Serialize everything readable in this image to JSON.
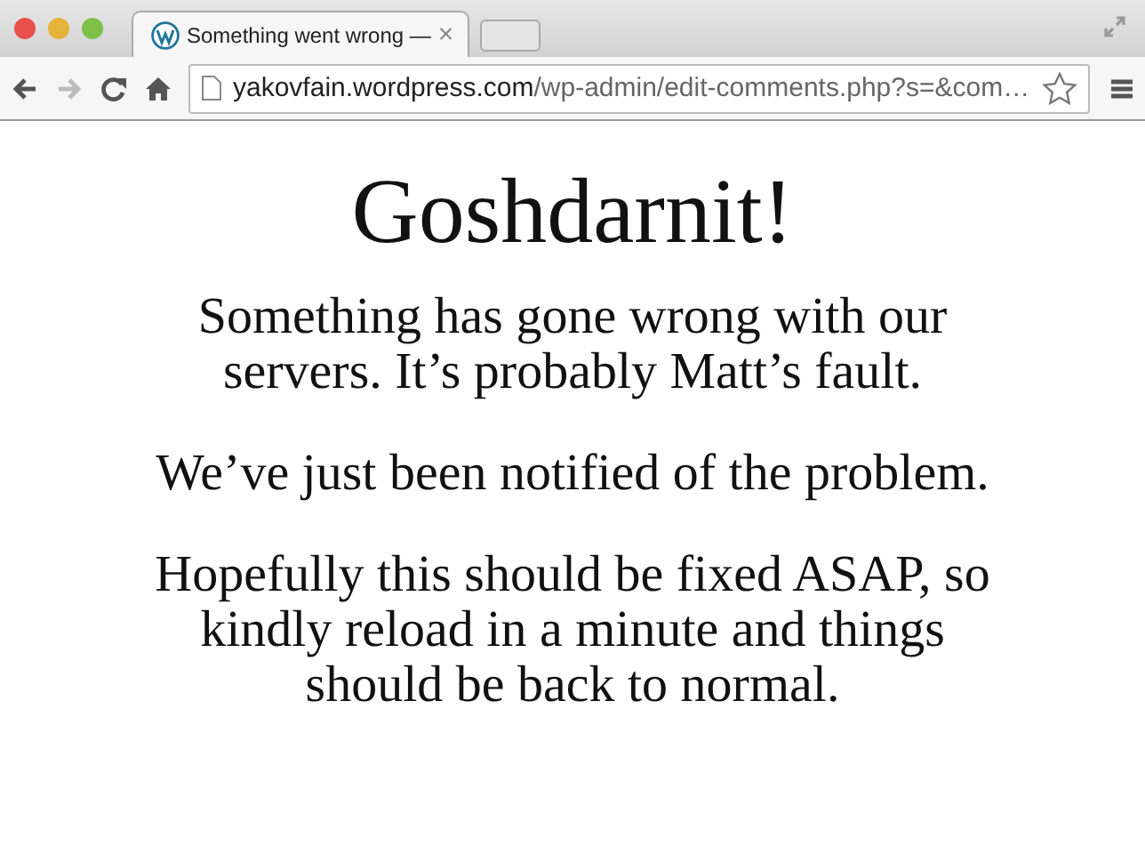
{
  "tab": {
    "title": "Something went wrong —",
    "close": "×",
    "selected": true
  },
  "nav": [
    {
      "kind": "back",
      "disabled": false
    },
    {
      "kind": "forward",
      "disabled": true
    },
    {
      "kind": "reload",
      "disabled": false
    },
    {
      "kind": "home",
      "disabled": false
    }
  ],
  "address": {
    "host": "yakovfain.wordpress.com",
    "path": "/wp-admin/edit-comments.php?s=&com…"
  },
  "page": {
    "heading": "Goshdarnit!",
    "paragraphs": [
      "Something has gone wrong with our servers. It’s probably Matt’s fault.",
      "We’ve just been notified of the problem.",
      "Hopefully this should be fixed ASAP, so kindly reload in a minute and things should be back to normal."
    ]
  }
}
